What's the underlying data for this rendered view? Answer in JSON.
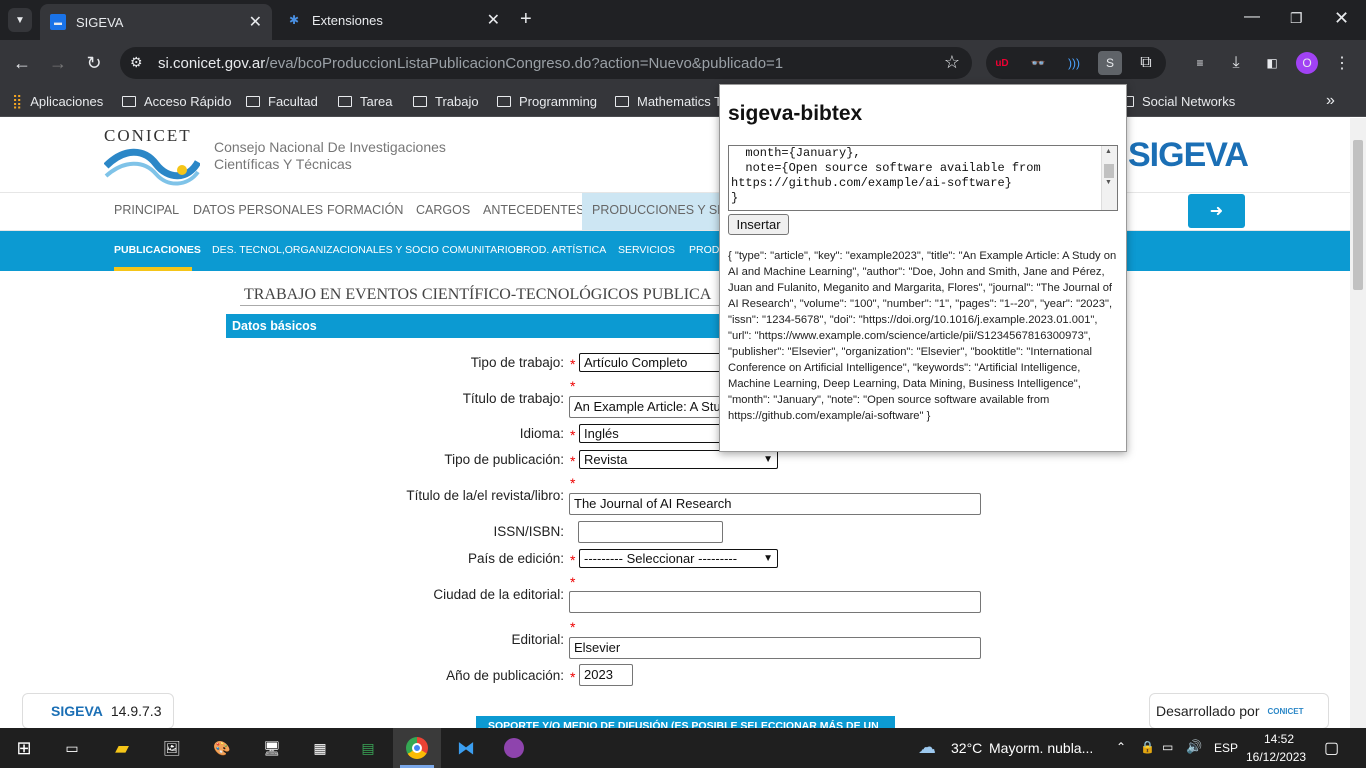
{
  "browser": {
    "tabs": [
      {
        "title": "SIGEVA"
      },
      {
        "title": "Extensiones"
      }
    ],
    "url_domain": "si.conicet.gov.ar",
    "url_path": "/eva/bcoProduccionListaPublicacionCongreso.do?action=Nuevo&publicado=1",
    "profile_initial": "O",
    "extension_s": "S"
  },
  "bookmarks": [
    "Aplicaciones",
    "Acceso Rápido",
    "Facultad",
    "Tarea",
    "Trabajo",
    "Programming",
    "Mathematics To",
    "Social Networks"
  ],
  "site": {
    "conicet_logo": "CONICET",
    "org_name_1": "Consejo Nacional De Investigaciones",
    "org_name_2": "Científicas Y Técnicas",
    "sigeva_logo": "SIGEVA",
    "main_nav": [
      "PRINCIPAL",
      "DATOS PERSONALES",
      "FORMACIÓN",
      "CARGOS",
      "ANTECEDENTES",
      "PRODUCCIONES Y SERV"
    ],
    "sub_nav": [
      "PUBLICACIONES",
      "DES. TECNOL,ORGANIZACIONALES Y SOCIO COMUNITARIOS",
      "PROD. ARTÍSTICA",
      "SERVICIOS",
      "PROD."
    ],
    "page_title": "TRABAJO EN EVENTOS CIENTÍFICO-TECNOLÓGICOS PUBLICA",
    "section_title": "Datos básicos",
    "footer_section": "SOPORTE Y/O MEDIO DE DIFUSIÓN (ES POSIBLE SELECCIONAR MÁS DE UN",
    "version": "14.9.7.3",
    "developed_by": "Desarrollado por",
    "developed_logo": "CONICET"
  },
  "form": {
    "labels": {
      "tipo_trabajo": "Tipo de trabajo:",
      "titulo_trabajo": "Título de trabajo:",
      "idioma": "Idioma:",
      "tipo_publicacion": "Tipo de publicación:",
      "titulo_revista": "Título de la/el revista/libro:",
      "issn": "ISSN/ISBN:",
      "pais": "País de edición:",
      "ciudad": "Ciudad de la editorial:",
      "editorial": "Editorial:",
      "anio": "Año de publicación:"
    },
    "values": {
      "tipo_trabajo": "Artículo Completo",
      "titulo_trabajo": "An Example Article: A Stu",
      "idioma": "Inglés",
      "tipo_publicacion": "Revista",
      "titulo_revista": "The Journal of AI Research",
      "issn": "",
      "pais": "--------- Seleccionar ---------",
      "ciudad": "",
      "editorial": "Elsevier",
      "anio": "2023"
    },
    "required_mark": "*"
  },
  "popup": {
    "title": "sigeva-bibtex",
    "textarea": "  month={January},\n  note={Open source software available from\nhttps://github.com/example/ai-software}\n}",
    "insert_label": "Insertar",
    "json_output": "{ \"type\": \"article\", \"key\": \"example2023\", \"title\": \"An Example Article: A Study on AI and Machine Learning\", \"author\": \"Doe, John and Smith, Jane and Pérez, Juan and Fulanito, Meganito and Margarita, Flores\", \"journal\": \"The Journal of AI Research\", \"volume\": \"100\", \"number\": \"1\", \"pages\": \"1--20\", \"year\": \"2023\", \"issn\": \"1234-5678\", \"doi\": \"https://doi.org/10.1016/j.example.2023.01.001\", \"url\": \"https://www.example.com/science/article/pii/S1234567816300973\", \"publisher\": \"Elsevier\", \"organization\": \"Elsevier\", \"booktitle\": \"International Conference on Artificial Intelligence\", \"keywords\": \"Artificial Intelligence, Machine Learning, Deep Learning, Data Mining, Business Intelligence\", \"month\": \"January\", \"note\": \"Open source software available from https://github.com/example/ai-software\" }"
  },
  "taskbar": {
    "weather": "32°C",
    "weather_text": "Mayorm. nubla...",
    "lang": "ESP",
    "time": "14:52",
    "date": "16/12/2023"
  },
  "colors": {
    "accent": "#0c9ad2",
    "chrome_dark": "#202124",
    "chrome_mid": "#35363a"
  }
}
